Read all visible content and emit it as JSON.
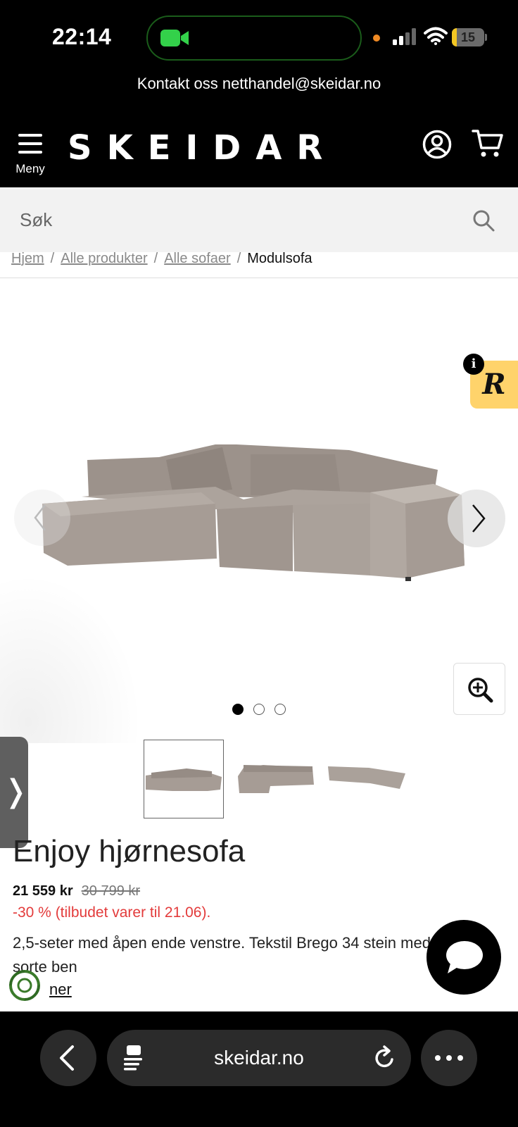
{
  "status_bar": {
    "time": "22:14",
    "battery": "15",
    "battery_level": 0.15
  },
  "contact": {
    "text": "Kontakt oss netthandel@skeidar.no"
  },
  "header": {
    "logo": "SKEIDAR",
    "menu_label": "Meny"
  },
  "search": {
    "placeholder": "Søk"
  },
  "breadcrumb": {
    "items": [
      "Hjem",
      "Alle produkter",
      "Alle sofaer"
    ],
    "current": "Modulsofa",
    "separator": "/"
  },
  "reviews_widget": {
    "info": "i",
    "logo_letter": "R"
  },
  "gallery": {
    "image_count": 3,
    "active_index": 0
  },
  "product": {
    "title": "Enjoy hjørnesofa",
    "price": "21 559 kr",
    "old_price": "30 799 kr",
    "discount": "-30 % (tilbudet varer til 21.06).",
    "description": "2,5-seter med åpen ende venstre. Tekstil Brego 34 stein med sorte ben",
    "more_link": "ner"
  },
  "browser": {
    "url": "skeidar.no"
  },
  "colors": {
    "header_bg": "#000000",
    "search_bg": "#f2f2f2",
    "discount": "#e33b3b",
    "review_widget": "#ffd36b",
    "sofa": "#a39890"
  }
}
